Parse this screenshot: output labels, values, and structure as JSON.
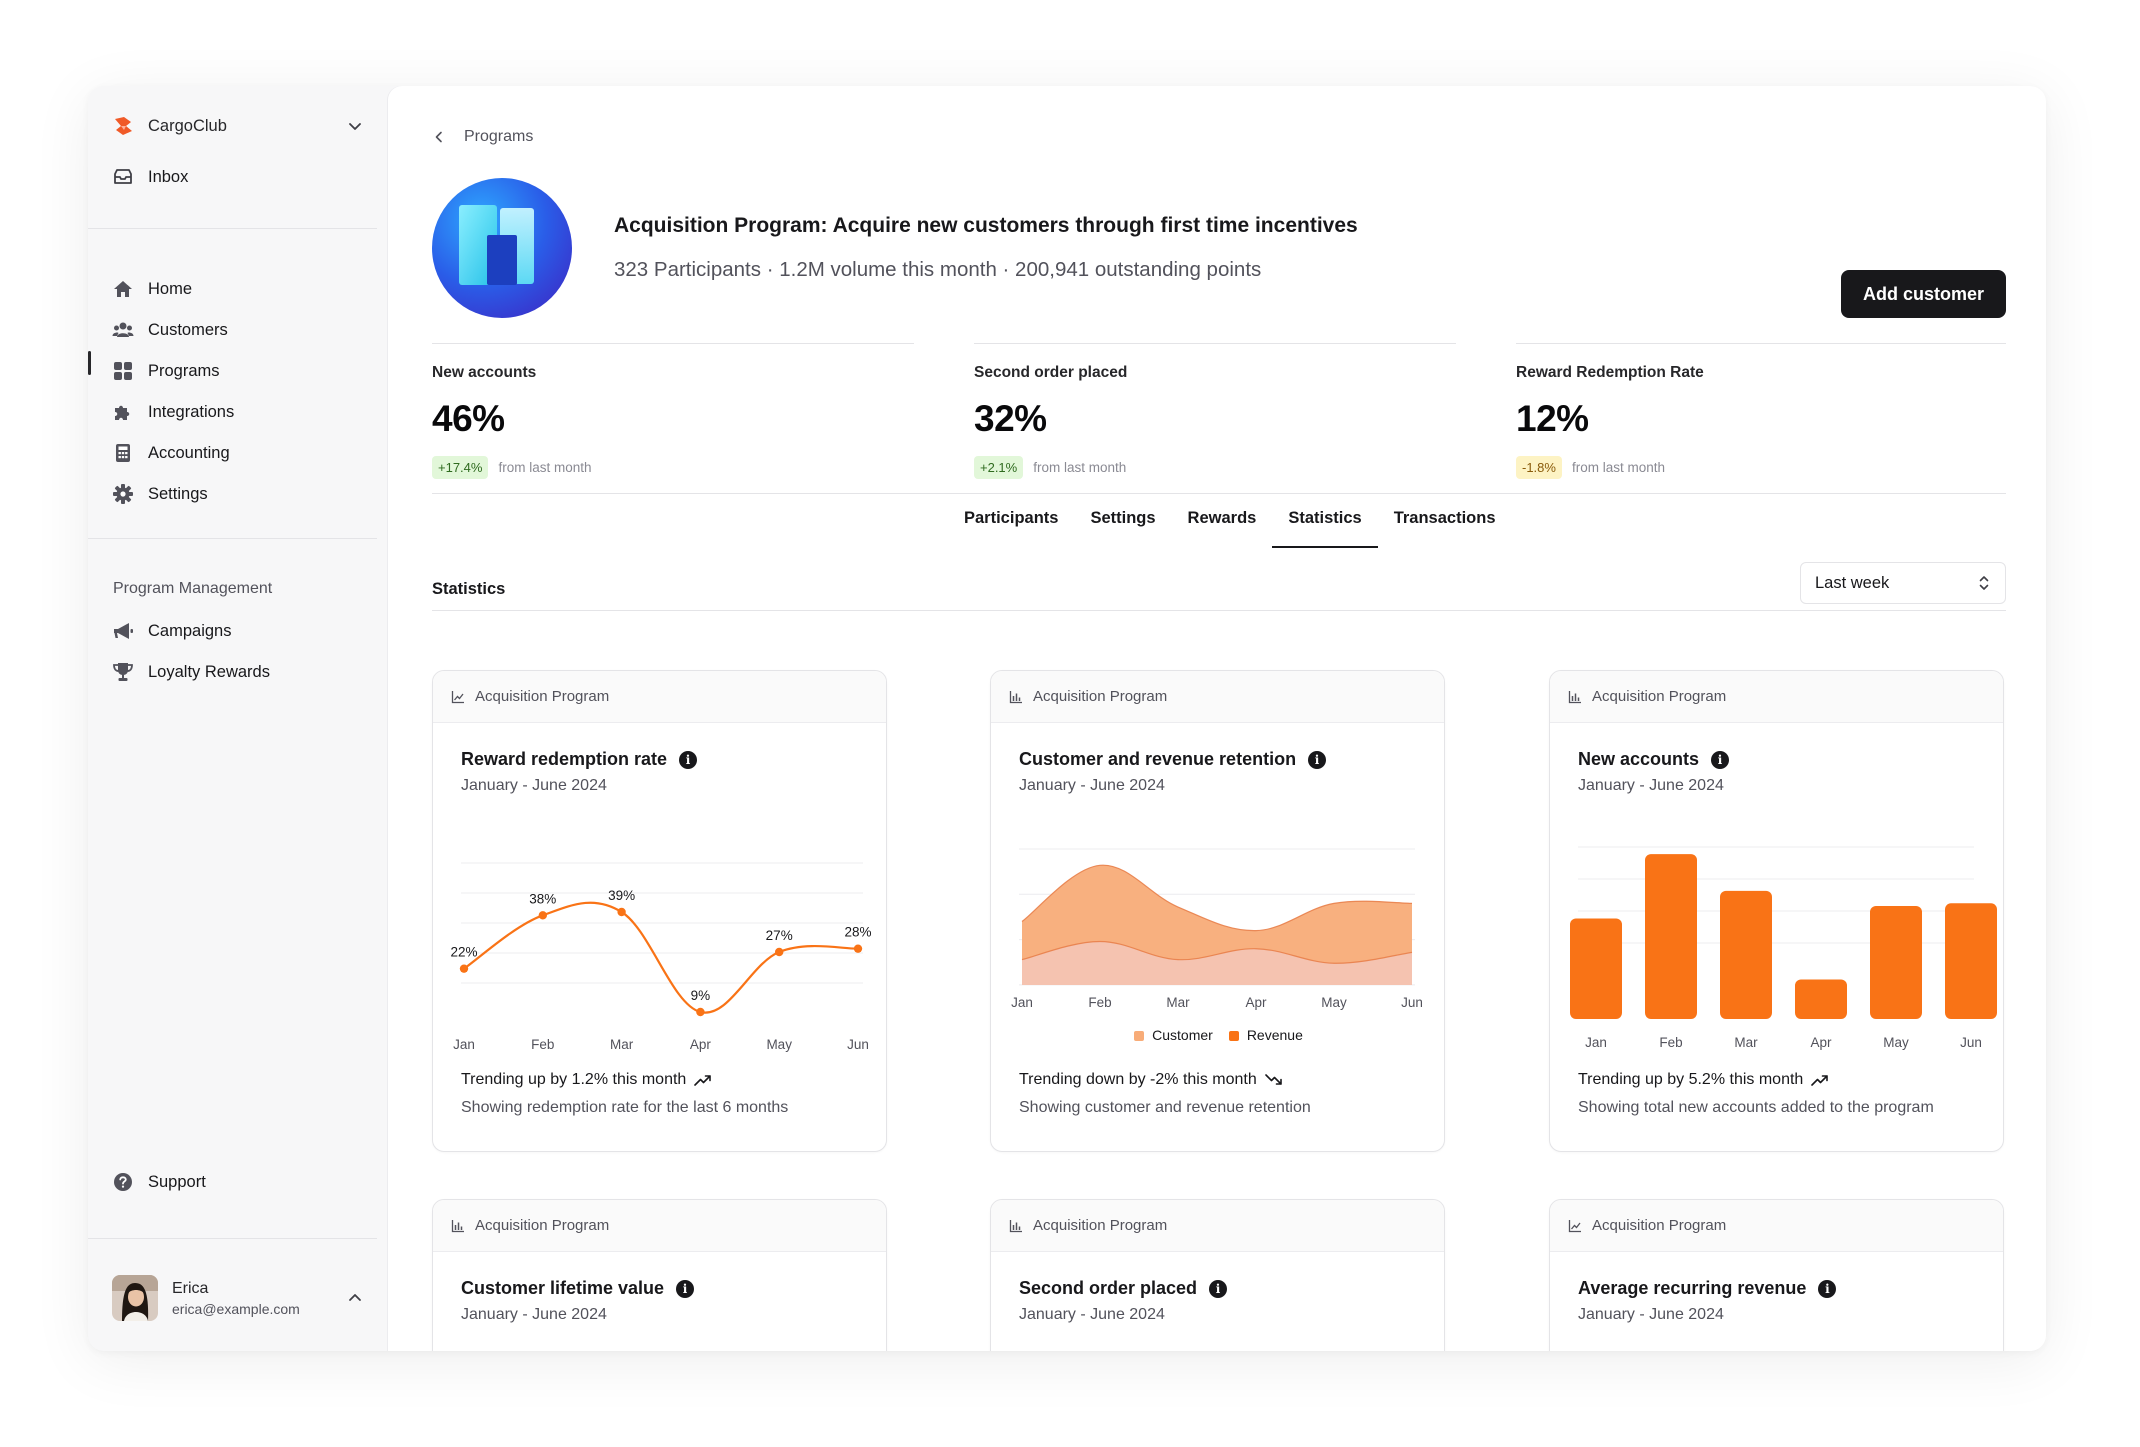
{
  "sidebar": {
    "workspace": "CargoClub",
    "inbox": "Inbox",
    "items": [
      {
        "label": "Home",
        "icon": "home-icon"
      },
      {
        "label": "Customers",
        "icon": "users-icon"
      },
      {
        "label": "Programs",
        "icon": "grid-icon"
      },
      {
        "label": "Integrations",
        "icon": "puzzle-icon"
      },
      {
        "label": "Accounting",
        "icon": "calculator-icon"
      },
      {
        "label": "Settings",
        "icon": "gear-icon"
      }
    ],
    "active_item": "Programs",
    "section_label": "Program Management",
    "section_items": [
      {
        "label": "Campaigns",
        "icon": "megaphone-icon"
      },
      {
        "label": "Loyalty Rewards",
        "icon": "trophy-icon"
      }
    ],
    "support": "Support",
    "user": {
      "name": "Erica",
      "email": "erica@example.com"
    }
  },
  "breadcrumb": {
    "back_label": "Programs"
  },
  "program": {
    "title": "Acquisition Program: Acquire new customers through first time incentives",
    "subtitle": "323 Participants · 1.2M volume this month · 200,941 outstanding points",
    "add_button": "Add customer"
  },
  "kpis": [
    {
      "label": "New accounts",
      "value": "46%",
      "delta": "+17.4%",
      "direction": "up",
      "delta_text": "from last month"
    },
    {
      "label": "Second order placed",
      "value": "32%",
      "delta": "+2.1%",
      "direction": "up",
      "delta_text": "from last month"
    },
    {
      "label": "Reward Redemption Rate",
      "value": "12%",
      "delta": "-1.8%",
      "direction": "down",
      "delta_text": "from last month"
    }
  ],
  "tabs": [
    "Participants",
    "Settings",
    "Rewards",
    "Statistics",
    "Transactions"
  ],
  "active_tab": "Statistics",
  "statistics": {
    "title": "Statistics",
    "range_select": "Last week"
  },
  "colors": {
    "accent": "#f97316",
    "accent_light": "#f8ac78",
    "accent_pale": "#f4c7b8",
    "dark": "#18181b"
  },
  "cards": [
    {
      "program": "Acquisition Program",
      "head_icon": "line-chart-icon",
      "title": "Reward redemption rate",
      "period": "January - June 2024",
      "trend": "Trending up by 1.2% this month",
      "trend_icon": "trending-up-icon",
      "footer": "Showing redemption rate for the last 6 months"
    },
    {
      "program": "Acquisition Program",
      "head_icon": "bar-chart-icon",
      "title": "Customer and revenue retention",
      "period": "January - June 2024",
      "trend": "Trending down by -2% this month",
      "trend_icon": "trending-down-icon",
      "footer": "Showing customer and revenue retention"
    },
    {
      "program": "Acquisition Program",
      "head_icon": "bar-chart-icon",
      "title": "New accounts",
      "period": "January - June 2024",
      "trend": "Trending up by 5.2% this month",
      "trend_icon": "trending-up-icon",
      "footer": "Showing total new accounts added to the program"
    },
    {
      "program": "Acquisition Program",
      "head_icon": "bar-chart-icon",
      "title": "Customer lifetime value",
      "period": "January - June 2024"
    },
    {
      "program": "Acquisition Program",
      "head_icon": "bar-chart-icon",
      "title": "Second order placed",
      "period": "January - June 2024"
    },
    {
      "program": "Acquisition Program",
      "head_icon": "line-chart-icon",
      "title": "Average recurring revenue",
      "period": "January - June 2024"
    }
  ],
  "chart_data": [
    {
      "type": "line",
      "categories": [
        "Jan",
        "Feb",
        "Mar",
        "Apr",
        "May",
        "Jun"
      ],
      "series": [
        {
          "values": [
            22,
            38,
            39,
            9,
            27,
            28
          ]
        }
      ],
      "data_labels": [
        "22%",
        "38%",
        "39%",
        "9%",
        "27%",
        "28%"
      ],
      "ylim": [
        0,
        45
      ],
      "grid": true,
      "color": "#f97316"
    },
    {
      "type": "area",
      "categories": [
        "Jan",
        "Feb",
        "Mar",
        "Apr",
        "May",
        "Jun"
      ],
      "series": [
        {
          "name": "Customer",
          "values": [
            70,
            132,
            86,
            60,
            90,
            90
          ],
          "color": "#f8ac78"
        },
        {
          "name": "Revenue",
          "values": [
            28,
            48,
            28,
            40,
            24,
            36
          ],
          "color": "#f4c7b8"
        }
      ],
      "ylim": [
        0,
        150
      ],
      "grid": true,
      "legend": "bottom"
    },
    {
      "type": "bar",
      "categories": [
        "Jan",
        "Feb",
        "Mar",
        "Apr",
        "May",
        "Jun"
      ],
      "series": [
        {
          "values": [
            186,
            305,
            237,
            73,
            209,
            214
          ]
        }
      ],
      "ylim": [
        0,
        320
      ],
      "grid": true,
      "color": "#f97316"
    }
  ]
}
